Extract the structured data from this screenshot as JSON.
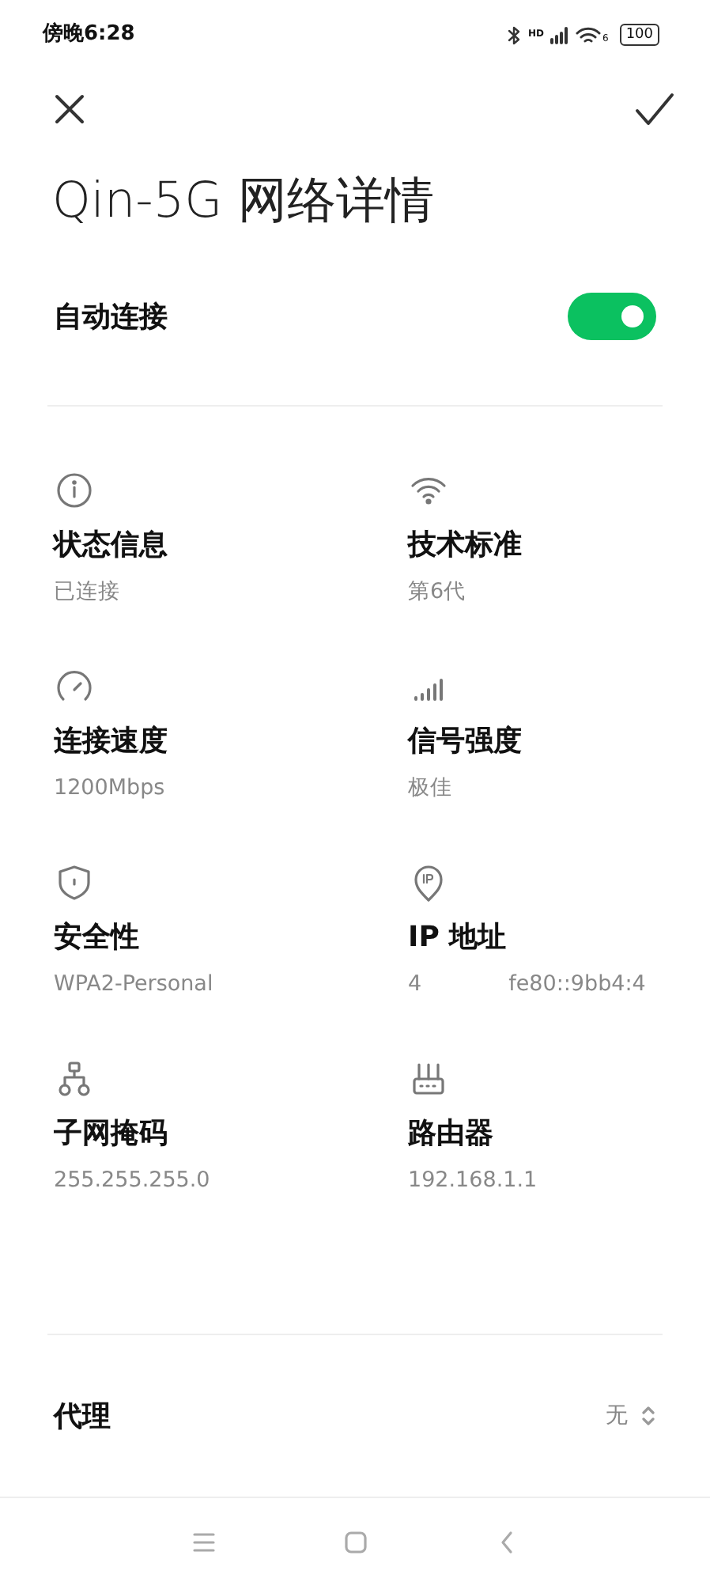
{
  "status_bar": {
    "time": "傍晚6:28",
    "signal_badge": "HD",
    "wifi_badge": "6",
    "battery": "100"
  },
  "title": "Qin-5G 网络详情",
  "auto_connect": {
    "label": "自动连接",
    "on": true
  },
  "details": [
    {
      "label": "状态信息",
      "values": [
        "已连接"
      ]
    },
    {
      "label": "技术标准",
      "values": [
        "第6代"
      ]
    },
    {
      "label": "连接速度",
      "values": [
        "1200Mbps"
      ]
    },
    {
      "label": "信号强度",
      "values": [
        "极佳"
      ]
    },
    {
      "label": "安全性",
      "values": [
        "WPA2-Personal"
      ]
    },
    {
      "label": "IP 地址",
      "values": [
        "4",
        "fe80::9bb4:4"
      ]
    },
    {
      "label": "子网掩码",
      "values": [
        "255.255.255.0"
      ]
    },
    {
      "label": "路由器",
      "values": [
        "192.168.1.1"
      ]
    }
  ],
  "proxy": {
    "label": "代理",
    "value": "无"
  }
}
